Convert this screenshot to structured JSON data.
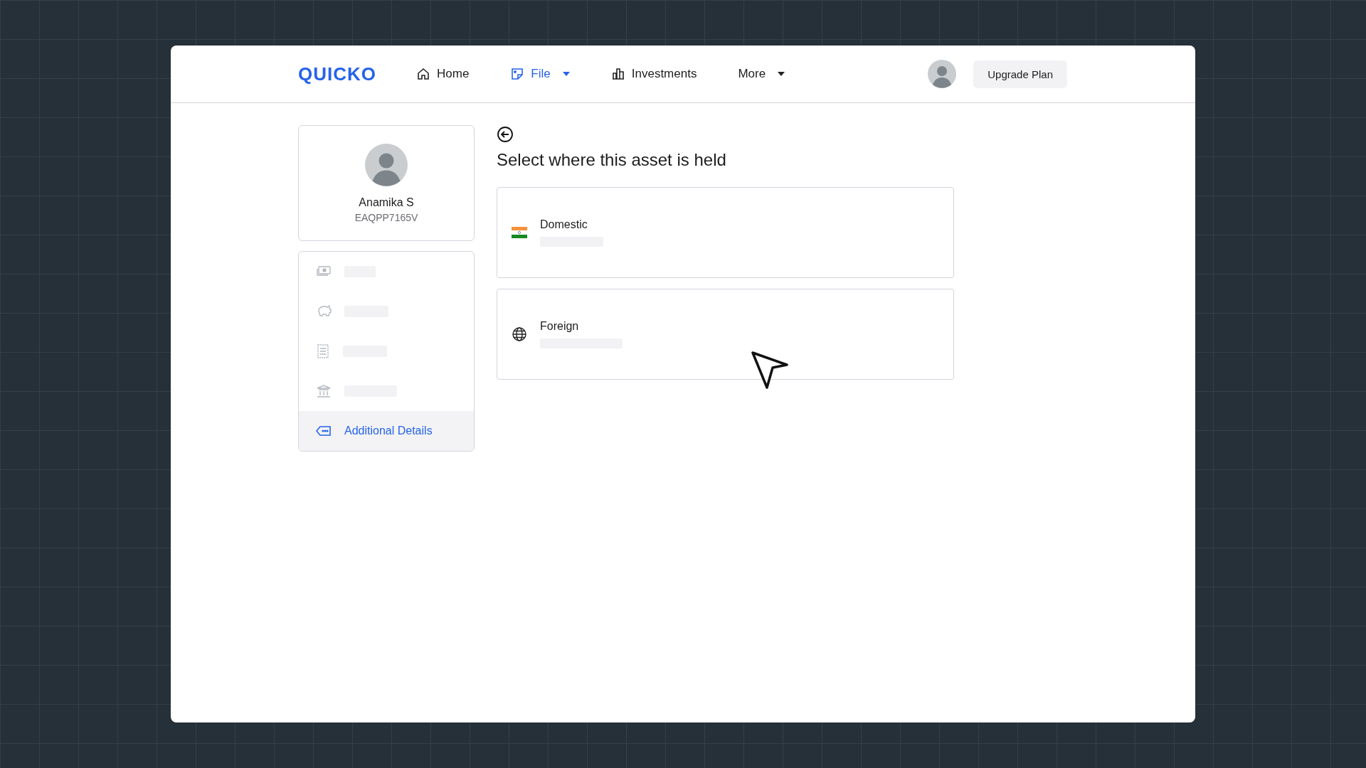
{
  "header": {
    "logo": "QUICKO",
    "nav": [
      {
        "label": "Home",
        "selected": false,
        "dropdown": false
      },
      {
        "label": "File",
        "selected": true,
        "dropdown": true
      },
      {
        "label": "Investments",
        "selected": false,
        "dropdown": false
      },
      {
        "label": "More",
        "selected": false,
        "dropdown": true
      }
    ],
    "upgrade_button": "Upgrade Plan"
  },
  "profile": {
    "name": "Anamika S",
    "pan": "EAQPP7165V"
  },
  "sidebar": {
    "items": [
      {
        "selected": false
      },
      {
        "selected": false
      },
      {
        "selected": false
      },
      {
        "selected": false
      },
      {
        "label": "Additional Details",
        "selected": true
      }
    ]
  },
  "main": {
    "heading": "Select where this asset is held",
    "options": [
      {
        "kind": "flag",
        "label": "Domestic"
      },
      {
        "kind": "globe",
        "label": "Foreign"
      }
    ]
  }
}
